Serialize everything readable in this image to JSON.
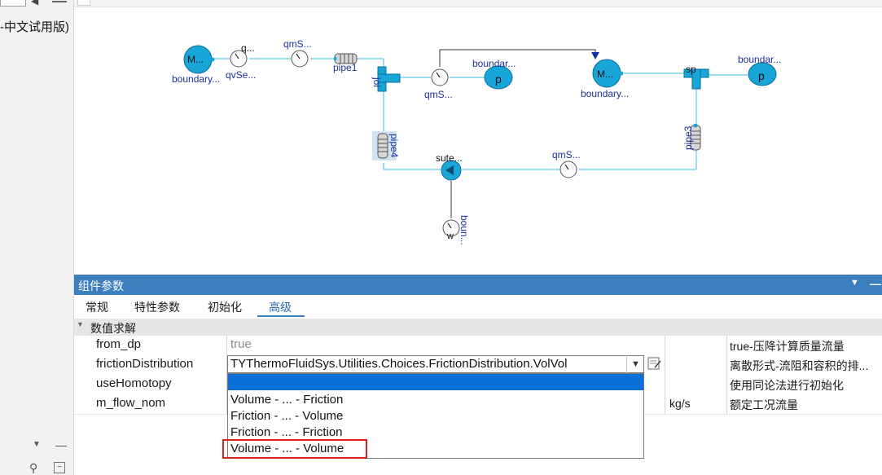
{
  "sidebar": {
    "title": "-中文试用版)"
  },
  "diagram": {
    "labels": {
      "m1": "M...",
      "boundary1": "boundary...",
      "qvse_top": "q...",
      "qvse": "qvSe...",
      "qms1": "qmS...",
      "pipe1": "pipe1",
      "joi": "joi",
      "qms2": "qmS...",
      "boundar_p1": "boundar...",
      "p1": "p",
      "m2": "M...",
      "boundary2": "boundary...",
      "sp": "sp",
      "boundar_p2": "boundar...",
      "p2": "p",
      "pipe4": "pipe4",
      "pipe3": "pipe3",
      "sute": "sute...",
      "qms3": "qmS...",
      "boun": "boun...",
      "w": "w"
    }
  },
  "panel": {
    "title": "组件参数",
    "tabs": [
      "常规",
      "特性参数",
      "初始化",
      "高级"
    ],
    "active_tab": "高级",
    "section": "数值求解",
    "rows": [
      {
        "name": "from_dp",
        "value": "true",
        "desc": "true-压降计算质量流量"
      },
      {
        "name": "frictionDistribution",
        "value": "TYThermoFluidSys.Utilities.Choices.FrictionDistribution.VolVol",
        "desc": "离散形式-流阻和容积的排..."
      },
      {
        "name": "useHomotopy",
        "value": "",
        "desc": "使用同论法进行初始化"
      },
      {
        "name": "m_flow_nom",
        "value": "",
        "unit": "kg/s",
        "desc": "额定工况流量"
      }
    ],
    "dropdown_options": [
      "",
      "Volume - ... - Friction",
      "Friction - ... - Volume",
      "Friction - ... - Friction",
      "Volume - ... - Volume"
    ],
    "highlighted_option": "Volume - ... - Volume"
  },
  "colors": {
    "header_blue": "#3d7ebf",
    "component_fill": "#18a5d8",
    "connection": "#7fd3ee",
    "label_blue": "#1a2f9e",
    "selection_blue": "#0a70d8",
    "highlight_red": "#e01e1e"
  }
}
